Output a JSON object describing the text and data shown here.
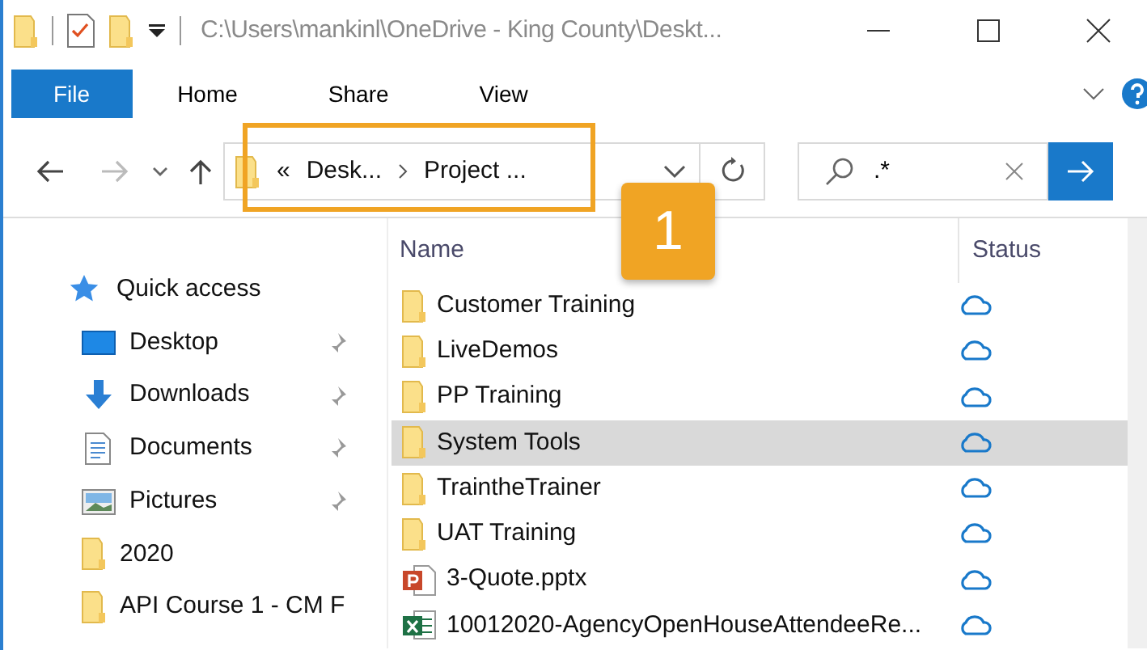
{
  "window": {
    "title": "C:\\Users\\mankinl\\OneDrive - King County\\Deskt..."
  },
  "ribbon_tabs": [
    {
      "label": "File",
      "selected": true
    },
    {
      "label": "Home",
      "selected": false
    },
    {
      "label": "Share",
      "selected": false
    },
    {
      "label": "View",
      "selected": false
    }
  ],
  "address_bar": {
    "overflow": "«",
    "segments": [
      "Desk...",
      "Project ..."
    ]
  },
  "search": {
    "value": ".*"
  },
  "annotation": {
    "label": "1"
  },
  "nav_pane": {
    "items": [
      {
        "label": "Quick access",
        "kind": "header",
        "pinned": false
      },
      {
        "label": "Desktop",
        "kind": "desktop",
        "pinned": true
      },
      {
        "label": "Downloads",
        "kind": "downloads",
        "pinned": true
      },
      {
        "label": "Documents",
        "kind": "documents",
        "pinned": true
      },
      {
        "label": "Pictures",
        "kind": "pictures",
        "pinned": true
      },
      {
        "label": "2020",
        "kind": "folder",
        "pinned": false
      },
      {
        "label": "API Course 1 - CM F",
        "kind": "folder",
        "pinned": false
      }
    ]
  },
  "file_list": {
    "columns": [
      "Name",
      "Status"
    ],
    "rows": [
      {
        "name": "Customer Training",
        "kind": "folder",
        "selected": false
      },
      {
        "name": "LiveDemos",
        "kind": "folder",
        "selected": false
      },
      {
        "name": "PP Training",
        "kind": "folder",
        "selected": false
      },
      {
        "name": "System Tools",
        "kind": "folder",
        "selected": true
      },
      {
        "name": "TraintheTrainer",
        "kind": "folder",
        "selected": false
      },
      {
        "name": "UAT Training",
        "kind": "folder",
        "selected": false
      },
      {
        "name": "3-Quote.pptx",
        "kind": "pptx",
        "selected": false
      },
      {
        "name": "10012020-AgencyOpenHouseAttendeeRe...",
        "kind": "xlsx",
        "selected": false
      }
    ]
  }
}
